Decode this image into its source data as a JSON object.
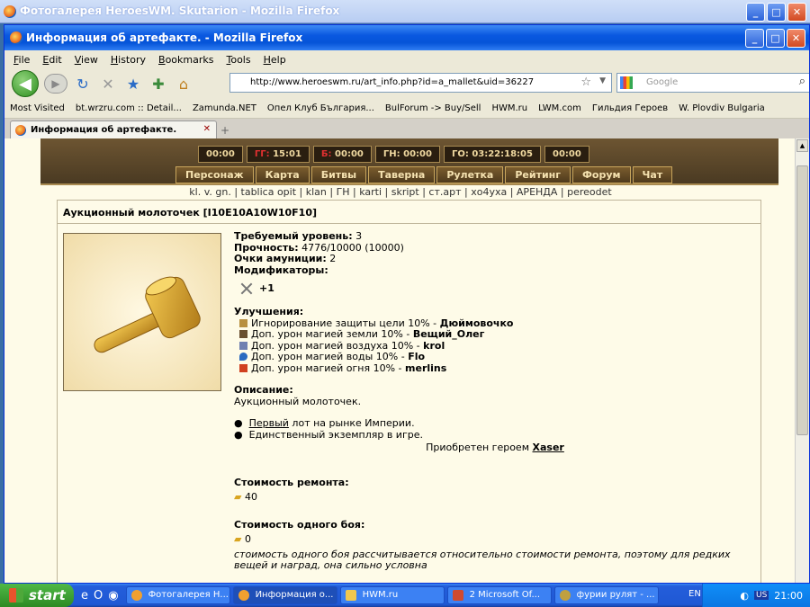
{
  "bg_window": {
    "title": "Фотогалерея HeroesWM. Skutarion - Mozilla Firefox"
  },
  "window": {
    "title": "Информация об артефакте. - Mozilla Firefox"
  },
  "menu": [
    "File",
    "Edit",
    "View",
    "History",
    "Bookmarks",
    "Tools",
    "Help"
  ],
  "url": "http://www.heroeswm.ru/art_info.php?id=a_mallet&uid=36227",
  "search_placeholder": "Google",
  "bookmarks": [
    "Most Visited",
    "bt.wrzru.com :: Detail...",
    "Zamunda.NET",
    "Опел Клуб България...",
    "BulForum -> Buy/Sell",
    "HWM.ru",
    "LWM.com",
    "Гильдия Героев",
    "W. Plovdiv Bulgaria"
  ],
  "tab": "Информация об артефакте.",
  "timers": [
    {
      "label": "",
      "value": "00:00"
    },
    {
      "label": "ГГ:",
      "value": "15:01"
    },
    {
      "label": "Б:",
      "value": "00:00"
    },
    {
      "label": "ГН:",
      "value": "00:00"
    },
    {
      "label": "ГО:",
      "value": "03:22:18:05"
    },
    {
      "label": "",
      "value": "00:00"
    }
  ],
  "game_menu": [
    "Персонаж",
    "Карта",
    "Битвы",
    "Таверна",
    "Рулетка",
    "Рейтинг",
    "Форум",
    "Чат"
  ],
  "links_line": "kl. v. gn. | tablica opit | klan | ГН | karti | skript | ст.арт | хо4уха | АРЕНДА | pereodet",
  "artifact": {
    "title": "Аукционный молоточек [I10E10A10W10F10]",
    "req_level_label": "Требуемый уровень:",
    "req_level": "3",
    "durability_label": "Прочность:",
    "durability": "4776/10000  (10000)",
    "ammo_label": "Очки амуниции:",
    "ammo": "2",
    "modifiers_label": "Модификаторы:",
    "modifier_value": "+1",
    "upgrades_label": "Улучшения:",
    "upgrades": [
      {
        "text": "Игнорирование защиты цели 10% - ",
        "by": "Дюймовочко",
        "color": "#b89040"
      },
      {
        "text": "Доп. урон магией земли 10% - ",
        "by": "Вещий_Олег",
        "color": "#6a5030"
      },
      {
        "text": "Доп. урон магией воздуха 10% - ",
        "by": "krol",
        "color": "#7080b0"
      },
      {
        "text": "Доп. урон магией воды 10% - ",
        "by": "Flo",
        "color": "#2a6ac0"
      },
      {
        "text": "Доп. урон магией огня 10% - ",
        "by": "merlins",
        "color": "#d04020"
      }
    ],
    "desc_label": "Описание:",
    "desc": "Аукционный молоточек.",
    "bullet1_link": "Первый",
    "bullet1_rest": " лот на рынке Империи.",
    "bullet2": "Единственный экземпляр в игре.",
    "acquired_label": "Приобретен героем ",
    "acquired_by": "Xaser",
    "repair_label": "Стоимость ремонта:",
    "repair": "40",
    "battle_label": "Стоимость одного боя:",
    "battle": "0",
    "note": "стоимость одного боя рассчитывается относительно стоимости ремонта, поэтому для редких вещей и наград, она сильно условна"
  },
  "taskbar": {
    "start": "start",
    "tasks": [
      "Фотогалерея Н...",
      "Информация о...",
      "HWM.ru",
      "2 Microsoft Of...",
      "фурии рулят - ..."
    ],
    "lang": "EN",
    "clock": "21:00",
    "kb": "US"
  }
}
